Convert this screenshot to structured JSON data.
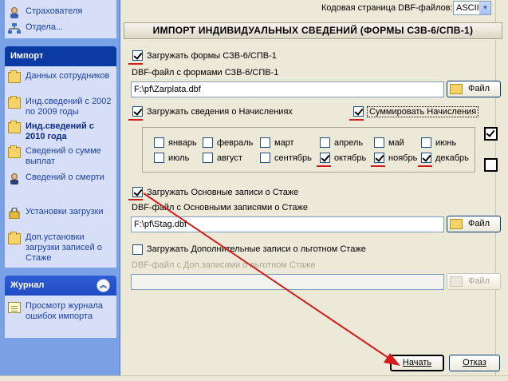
{
  "sidebar": {
    "top_items": [
      {
        "label": "Страхователя",
        "icon": "person-icon"
      },
      {
        "label": "Отдела...",
        "icon": "org-chart-icon"
      }
    ],
    "import_panel": {
      "title": "Импорт",
      "items": [
        {
          "label": "Данных сотрудников",
          "icon": "folder-icon"
        },
        {
          "label": "Инд.сведений с 2002 по 2009 годы",
          "icon": "folder-icon"
        },
        {
          "label": "Инд.сведений с 2010 года",
          "icon": "folder-icon",
          "active": true
        },
        {
          "label": "Сведений о сумме выплат",
          "icon": "folder-icon"
        },
        {
          "label": "Сведений о смерти",
          "icon": "person-icon"
        },
        {
          "label": "Установки загрузки",
          "icon": "lock-icon"
        },
        {
          "label": "Доп.установки загрузки записей о Стаже",
          "icon": "folder-icon"
        }
      ]
    },
    "journal_panel": {
      "title": "Журнал",
      "collapse_glyph": "︽",
      "items": [
        {
          "label": "Просмотр журнала ошибок импорта",
          "icon": "notepad-icon"
        }
      ]
    }
  },
  "codepage": {
    "label": "Кодовая страница DBF-файлов:",
    "value": "ASCII"
  },
  "form": {
    "title": "ИМПОРТ ИНДИВИДУАЛЬНЫХ СВЕДЕНИЙ (ФОРМЫ СЗВ-6/СПВ-1)",
    "load_forms": {
      "label": "Загружать формы СЗВ-6/СПВ-1",
      "checked": true
    },
    "forms_file": {
      "label": "DBF-файл с формами СЗВ-6/СПВ-1",
      "value": "F:\\pf\\Zarplata.dbf",
      "button": "Файл"
    },
    "load_accruals": {
      "label": "Загружать сведения о Начислениях",
      "checked": true
    },
    "sum_accruals": {
      "label": "Суммировать Начисления",
      "checked": true
    },
    "months": [
      {
        "label": "январь",
        "checked": false
      },
      {
        "label": "февраль",
        "checked": false
      },
      {
        "label": "март",
        "checked": false
      },
      {
        "label": "апрель",
        "checked": false
      },
      {
        "label": "май",
        "checked": false
      },
      {
        "label": "июнь",
        "checked": false
      },
      {
        "label": "июль",
        "checked": false
      },
      {
        "label": "август",
        "checked": false
      },
      {
        "label": "сентябрь",
        "checked": false
      },
      {
        "label": "октябрь",
        "checked": true
      },
      {
        "label": "ноябрь",
        "checked": true
      },
      {
        "label": "декабрь",
        "checked": true
      }
    ],
    "load_main_stazh": {
      "label": "Загружать Основные записи о Стаже",
      "checked": true
    },
    "main_stazh_file": {
      "label": "DBF-файл с Основными записями о Стаже",
      "value": "F:\\pf\\Stag.dbf",
      "button": "Файл"
    },
    "load_extra_stazh": {
      "label": "Загружать Дополнительные записи о льготном Стаже",
      "checked": false
    },
    "extra_stazh_file": {
      "label": "DBF-файл с Доп.записями о льготном Стаже",
      "value": "",
      "button": "Файл"
    }
  },
  "actions": {
    "start": "Начать",
    "cancel": "Отказ"
  },
  "colors": {
    "sidebar_bg": "#7aa1e6",
    "annotation_red": "#d21c1c"
  }
}
